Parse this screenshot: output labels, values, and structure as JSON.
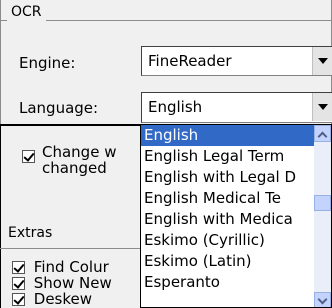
{
  "ocr_group": {
    "title": "OCR",
    "engine_label": "Engine:",
    "engine_value": "FineReader",
    "language_label": "Language:",
    "language_value": "English"
  },
  "options": {
    "change_label_line1": "Change w",
    "change_label_line2": "changed",
    "change_checked": true
  },
  "extras": {
    "title": "Extras",
    "items": [
      {
        "label": "Find Colur",
        "checked": true
      },
      {
        "label": "Show New",
        "checked": true
      },
      {
        "label": "Deskew",
        "checked": true
      }
    ]
  },
  "language_dropdown": {
    "selected_index": 0,
    "options": [
      "English",
      "English Legal Term",
      "English with Legal D",
      "English Medical Te",
      "English with Medica",
      "Eskimo (Cyrillic)",
      "Eskimo (Latin)",
      "Esperanto"
    ]
  },
  "colors": {
    "selection": "#3169c6",
    "scrollbar_button": "#c3d3fd"
  }
}
